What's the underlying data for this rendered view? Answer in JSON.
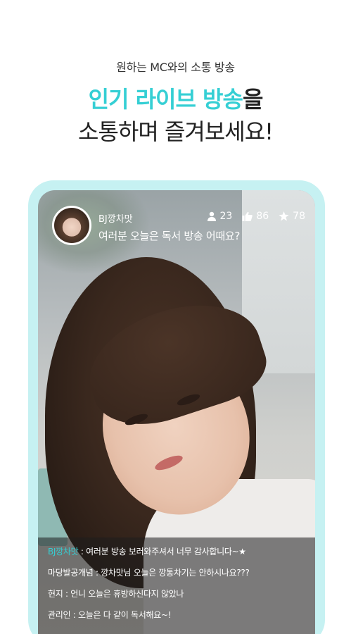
{
  "promo": {
    "subtitle": "원하는 MC와의 소통 방송",
    "headline_accent": "인기 라이브 방송",
    "headline_rest": "을",
    "headline_line2": "소통하며 즐겨보세요!"
  },
  "broadcast": {
    "bj_name": "BJ깡차맛",
    "title": "여러분 오늘은 독서 방송 어때요?",
    "stats": {
      "viewers": "23",
      "likes": "86",
      "stars": "78"
    },
    "icons": {
      "viewers": "person-icon",
      "likes": "thumbs-up-icon",
      "stars": "star-icon"
    }
  },
  "chat": [
    {
      "nick": "BJ깡차맛",
      "message": " : 여러분 방송 보러와주셔서 너무 감사합니다~★",
      "is_bj": true
    },
    {
      "nick": "마당발공개념",
      "message": " : 깡차맛님 오늘은 깡통차기는 안하시나요???",
      "is_bj": false
    },
    {
      "nick": "현지",
      "message": " : 언니 오늘은 휴방하신다지 않았나",
      "is_bj": false
    },
    {
      "nick": "관리인",
      "message": " : 오늘은 다 같이 독서해요~!",
      "is_bj": false
    }
  ],
  "colors": {
    "accent": "#35cfd4",
    "frame": "#c6f1f2"
  }
}
